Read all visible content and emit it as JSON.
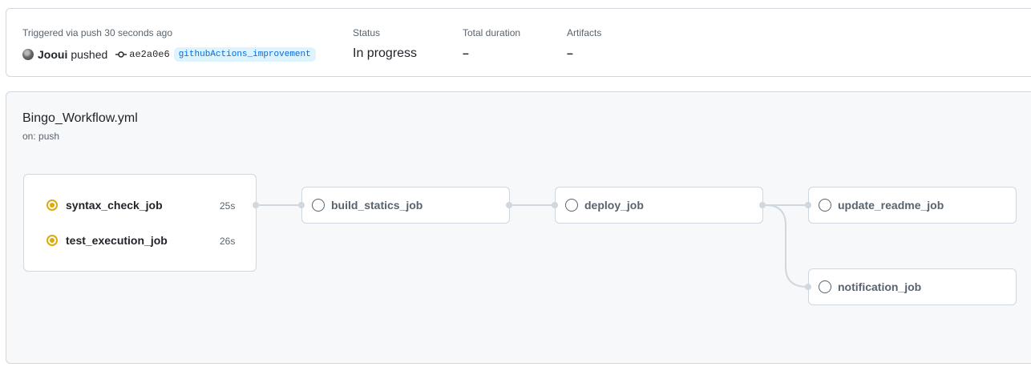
{
  "summary": {
    "triggered_label": "Triggered via push 30 seconds ago",
    "actor": "Jooui",
    "action": "pushed",
    "commit_sha": "ae2a0e6",
    "branch": "githubActions_improvement",
    "status_label": "Status",
    "status_value": "In progress",
    "duration_label": "Total duration",
    "duration_value": "–",
    "artifacts_label": "Artifacts",
    "artifacts_value": "–"
  },
  "workflow": {
    "name": "Bingo_Workflow.yml",
    "trigger": "on: push",
    "jobs": [
      {
        "name": "syntax_check_job",
        "status": "in_progress",
        "duration": "25s",
        "icon": "in-progress-icon"
      },
      {
        "name": "test_execution_job",
        "status": "in_progress",
        "duration": "26s",
        "icon": "in-progress-icon"
      },
      {
        "name": "build_statics_job",
        "status": "queued",
        "icon": "queued-icon"
      },
      {
        "name": "deploy_job",
        "status": "queued",
        "icon": "queued-icon"
      },
      {
        "name": "update_readme_job",
        "status": "queued",
        "icon": "queued-icon"
      },
      {
        "name": "notification_job",
        "status": "queued",
        "icon": "queued-icon"
      }
    ]
  },
  "colors": {
    "in_progress": "#dbab0a",
    "queued": "#59636e",
    "branch_bg": "#ddf4ff",
    "branch_text": "#0969da"
  }
}
